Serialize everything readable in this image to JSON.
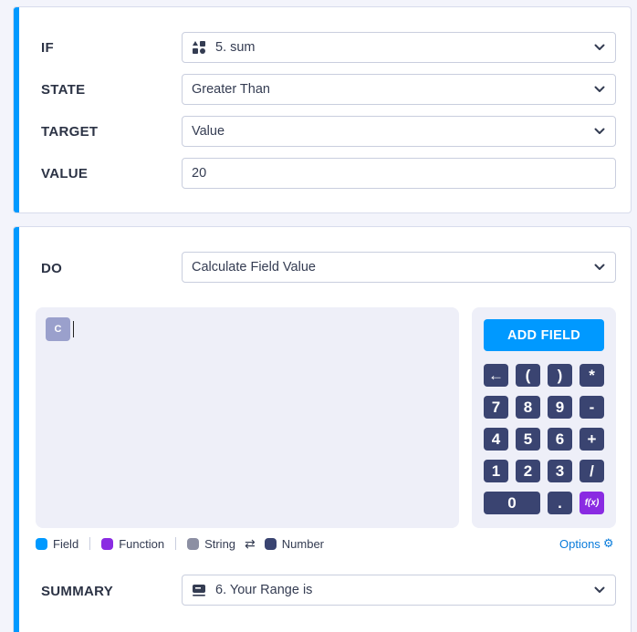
{
  "condition": {
    "if_label": "IF",
    "if_value": "5. sum",
    "state_label": "STATE",
    "state_value": "Greater Than",
    "target_label": "TARGET",
    "target_value": "Value",
    "value_label": "VALUE",
    "value_value": "20"
  },
  "action": {
    "do_label": "DO",
    "do_value": "Calculate Field Value",
    "chip_text": "C",
    "add_field_label": "ADD FIELD",
    "keys": [
      "←",
      "(",
      ")",
      "*",
      "7",
      "8",
      "9",
      "-",
      "4",
      "5",
      "6",
      "+",
      "1",
      "2",
      "3",
      "/",
      "0",
      ".",
      "f(x)"
    ],
    "legend": {
      "field": "Field",
      "function": "Function",
      "string": "String",
      "swap_symbol": "⇄",
      "number": "Number"
    },
    "options_label": "Options",
    "summary_label": "SUMMARY",
    "summary_value": "6. Your Range is"
  },
  "colors": {
    "accent": "#0099ff",
    "key_bg": "#3a4471",
    "function_purple": "#8a2be2",
    "field_blue": "#0099ff",
    "string_gray": "#8c8fa3",
    "number_navy": "#3a4471"
  },
  "icons": {
    "if_field_icon": "widget-shapes-icon",
    "summary_field_icon": "text-field-icon",
    "dropdown": "chevron-down-icon",
    "options": "gear-icon"
  }
}
